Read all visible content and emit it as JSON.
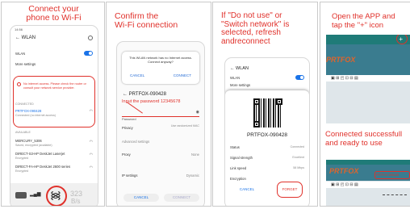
{
  "panel1": {
    "caption": [
      "Connect your",
      "phone to Wi-Fi"
    ],
    "status": "14:56",
    "title": "WLAN",
    "wlan_label": "WLAN",
    "more_settings": "More settings",
    "warning": "No internet access. Please check the router or consult your network service provider.",
    "connected_header": "CONNECTED",
    "connected_ssid": "PRTFOX-090428",
    "connected_sub": "Connected (no internet access)",
    "available_header": "AVAILABLE",
    "networks": [
      {
        "name": "MERCURY_5306",
        "sub": "Saved, encrypted (available)"
      },
      {
        "name": "DIRECT-S3-HP DeskJet Laserjet",
        "sub": "Encrypted"
      },
      {
        "name": "DIRECT-FA-HP DeskJet 2600 series",
        "sub": "Encrypted"
      }
    ],
    "speed": "323",
    "speed_unit": "B/s"
  },
  "panel2": {
    "caption": [
      "Confirm the",
      "Wi-Fi connection"
    ],
    "dialog_text": "This WLAN network has no Internet access. Connect anyway?",
    "dialog_cancel": "CANCEL",
    "dialog_connect": "CONNECT",
    "ssid": "PRTFOX-090428",
    "password_hint": "Input the password 12345678",
    "password_placeholder": "Password",
    "privacy": "Privacy",
    "privacy_value": "Use randomized MAC",
    "advanced": "Advanced settings",
    "proxy": "Proxy",
    "proxy_value": "None",
    "ip": "IP settings",
    "ip_value": "Dynamic",
    "cancel": "CANCEL",
    "connect": "CONNECT"
  },
  "panel3": {
    "caption": [
      "If \"Do not use\" or",
      "\"Switch network\" is",
      "selected, refresh",
      "andreconnect"
    ],
    "title": "WLAN",
    "wlan_label": "WLAN",
    "more_settings": "More settings",
    "qr_ssid": "PRTFOX-090428",
    "status_label": "Status",
    "status_value": "Connected",
    "signal_label": "Signal strength",
    "signal_value": "Excellent",
    "link_label": "Link speed",
    "link_value": "58 Mbps",
    "encryption_label": "Encryption",
    "cancel": "CANCEL",
    "forget": "FORGET"
  },
  "panel4": {
    "caption1": [
      "Open the APP and",
      "tap the \"+\" icon"
    ],
    "caption2": [
      "Connected successfull",
      "and ready to use"
    ],
    "logo1": "PRTFOX",
    "logo2": "PRTFOX",
    "device_tag": "PRTFOX-090428"
  }
}
